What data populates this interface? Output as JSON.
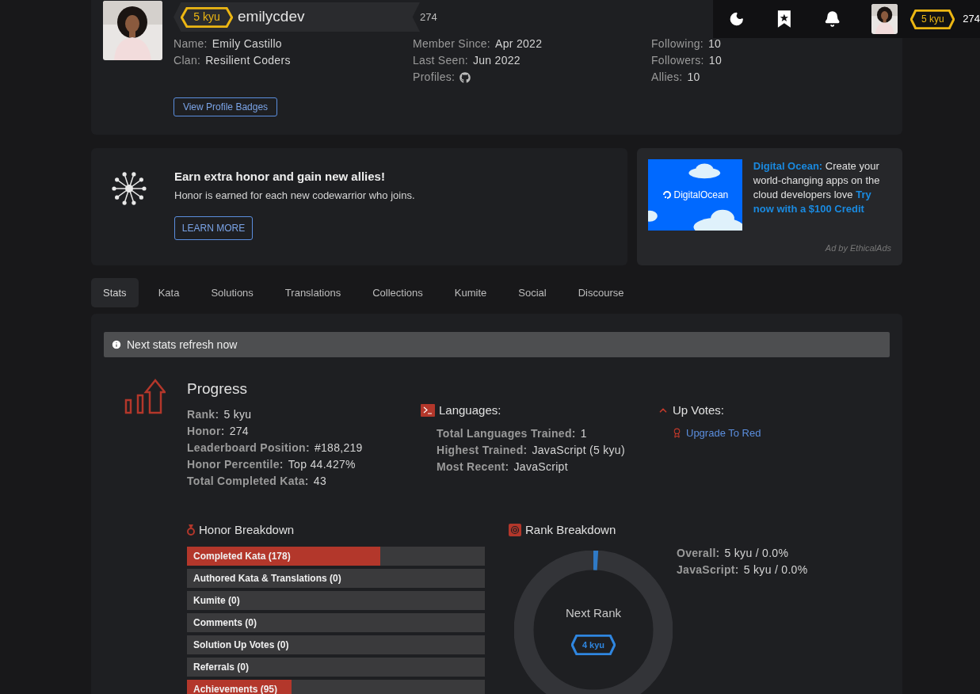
{
  "header": {
    "rank": "5 kyu",
    "honor": "274"
  },
  "profile": {
    "rank": "5 kyu",
    "username": "emilycdev",
    "honor": "274",
    "button": "View Profile Badges",
    "columns": [
      [
        {
          "kind": "text",
          "label": "Name:",
          "value": "Emily Castillo"
        },
        {
          "kind": "text",
          "label": "Clan:",
          "value": "Resilient Coders"
        }
      ],
      [
        {
          "kind": "text",
          "label": "Member Since:",
          "value": "Apr 2022"
        },
        {
          "kind": "text",
          "label": "Last Seen:",
          "value": "Jun 2022"
        },
        {
          "kind": "github",
          "label": "Profiles:"
        }
      ],
      [
        {
          "kind": "text",
          "label": "Following:",
          "value": "10"
        },
        {
          "kind": "text",
          "label": "Followers:",
          "value": "10"
        },
        {
          "kind": "text",
          "label": "Allies:",
          "value": "10"
        }
      ]
    ]
  },
  "referral": {
    "title": "Earn extra honor and gain new allies!",
    "text": "Honor is earned for each new codewarrior who joins.",
    "button": "LEARN MORE"
  },
  "ad": {
    "brand": "DigitalOcean",
    "sponsor": "Digital Ocean:",
    "text": "Create your world-changing apps on the cloud developers love",
    "cta": "Try now with a $100 Credit",
    "footer": "Ad by EthicalAds"
  },
  "tabs": [
    {
      "label": "Stats",
      "selected": true
    },
    {
      "label": "Kata",
      "selected": false
    },
    {
      "label": "Solutions",
      "selected": false
    },
    {
      "label": "Translations",
      "selected": false
    },
    {
      "label": "Collections",
      "selected": false
    },
    {
      "label": "Kumite",
      "selected": false
    },
    {
      "label": "Social",
      "selected": false
    },
    {
      "label": "Discourse",
      "selected": false
    }
  ],
  "notice": "Next stats refresh now",
  "progress": {
    "title": "Progress",
    "items": [
      {
        "label": "Rank:",
        "value": "5 kyu"
      },
      {
        "label": "Honor:",
        "value": "274"
      },
      {
        "label": "Leaderboard Position:",
        "value": "#188,219"
      },
      {
        "label": "Honor Percentile:",
        "value": "Top 44.427%"
      },
      {
        "label": "Total Completed Kata:",
        "value": "43"
      }
    ]
  },
  "languages": {
    "title": "Languages:",
    "items": [
      {
        "label": "Total Languages Trained:",
        "value": "1"
      },
      {
        "label": "Highest Trained:",
        "value": "JavaScript (5 kyu)"
      },
      {
        "label": "Most Recent:",
        "value": "JavaScript"
      }
    ]
  },
  "up_votes": {
    "title": "Up Votes:",
    "link": "Upgrade To Red"
  },
  "honor_breakdown": {
    "title": "Honor Breakdown",
    "bars": [
      {
        "label": "Completed Kata (178)",
        "level": 0.65
      },
      {
        "label": "Authored Kata & Translations (0)",
        "level": 0
      },
      {
        "label": "Kumite (0)",
        "level": 0
      },
      {
        "label": "Comments (0)",
        "level": 0
      },
      {
        "label": "Solution Up Votes (0)",
        "level": 0
      },
      {
        "label": "Referrals (0)",
        "level": 0
      },
      {
        "label": "Achievements (95)",
        "level": 0.35
      }
    ]
  },
  "rank_breakdown": {
    "title": "Rank Breakdown",
    "center_label": "Next Rank",
    "next_rank": "4 kyu",
    "level": 0.01,
    "items": [
      {
        "label": "Overall:",
        "value": "5 kyu / 0.0%"
      },
      {
        "label": "JavaScript:",
        "value": "5 kyu / 0.0%"
      }
    ]
  }
}
